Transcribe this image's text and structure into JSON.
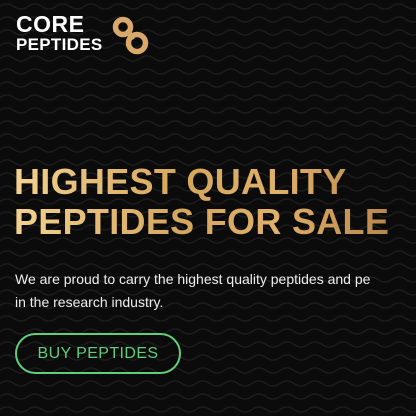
{
  "logo": {
    "line1": "CORE",
    "line2": "PEPTIDES",
    "mark_icon": "infinity-knot-icon",
    "mark_color": "#d9a86a"
  },
  "hero": {
    "title_line1": "HIGHEST QUALITY",
    "title_line2": "PEPTIDES FOR SALE",
    "text_line1": "We are proud to carry the highest quality peptides and pe",
    "text_line2": "in the research industry.",
    "cta_label": "BUY PEPTIDES"
  },
  "colors": {
    "background": "#0b0b0b",
    "title_gold": "#d9ab64",
    "cta_green": "#5fcf79",
    "text": "#eeeeee"
  }
}
